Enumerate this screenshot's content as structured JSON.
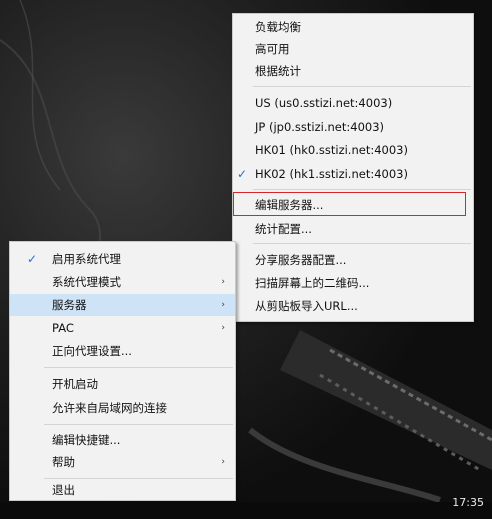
{
  "server_menu": {
    "items": [
      {
        "label": "负载均衡",
        "checked": false
      },
      {
        "label": "高可用",
        "checked": false
      },
      {
        "label": "根据统计",
        "checked": false
      },
      {
        "label": "US (us0.sstizi.net:4003)",
        "checked": false
      },
      {
        "label": "JP (jp0.sstizi.net:4003)",
        "checked": false
      },
      {
        "label": "HK01 (hk0.sstizi.net:4003)",
        "checked": false
      },
      {
        "label": "HK02 (hk1.sstizi.net:4003)",
        "checked": true
      },
      {
        "label": "编辑服务器...",
        "checked": false
      },
      {
        "label": "统计配置...",
        "checked": false
      },
      {
        "label": "分享服务器配置...",
        "checked": false
      },
      {
        "label": "扫描屏幕上的二维码...",
        "checked": false
      },
      {
        "label": "从剪贴板导入URL...",
        "checked": false
      }
    ]
  },
  "main_menu": {
    "items": [
      {
        "label": "启用系统代理",
        "checked": true,
        "submenu": false
      },
      {
        "label": "系统代理模式",
        "checked": false,
        "submenu": true
      },
      {
        "label": "服务器",
        "checked": false,
        "submenu": true,
        "highlighted": true
      },
      {
        "label": "PAC",
        "checked": false,
        "submenu": true
      },
      {
        "label": "正向代理设置...",
        "checked": false,
        "submenu": false
      },
      {
        "label": "开机启动",
        "checked": false,
        "submenu": false
      },
      {
        "label": "允许来自局域网的连接",
        "checked": false,
        "submenu": false
      },
      {
        "label": "编辑快捷键...",
        "checked": false,
        "submenu": false
      },
      {
        "label": "帮助",
        "checked": false,
        "submenu": true
      },
      {
        "label": "退出",
        "checked": false,
        "submenu": false
      }
    ]
  },
  "glyphs": {
    "check": "✓",
    "submenu_arrow": "›"
  },
  "colors": {
    "highlight": "#cfe3f7",
    "callout_border": "#d7262b",
    "check": "#2a6fc9"
  },
  "taskbar": {
    "time": "17:35"
  }
}
